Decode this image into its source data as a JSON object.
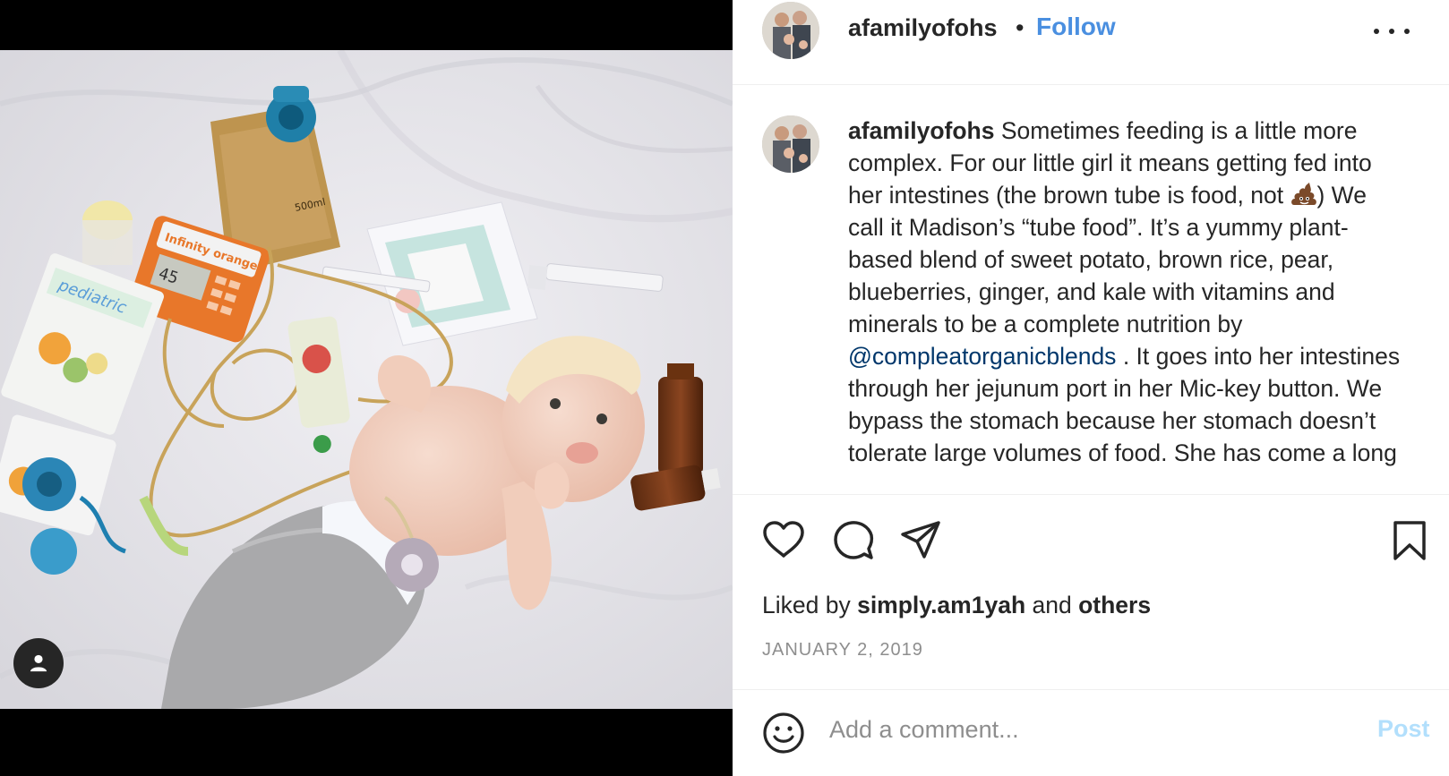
{
  "post": {
    "username": "afamilyofohs",
    "separator": "•",
    "follow_label": "Follow",
    "more_icon": "more-horizontal-icon",
    "caption": {
      "username": "afamilyofohs",
      "text_1": "Sometimes feeding is a little more complex. For our little girl it means getting fed into her intestines (the brown tube is food, not",
      "emoji": "poop-emoji",
      "text_2": ") We call it Madison’s “tube food”. It’s a yummy plant-based blend of sweet potato, brown rice, pear, blueberries, ginger, and kale with vitamins and minerals to be a complete nutrition by",
      "mention": "@compleatorganicblends",
      "text_3": ". It goes into her intestines through her jejunum port in her Mic-key button. We bypass the stomach because her stomach doesn’t tolerate large volumes of food. She has come a long"
    },
    "actions": {
      "like_icon": "heart-icon",
      "comment_icon": "comment-icon",
      "share_icon": "share-icon",
      "save_icon": "bookmark-icon"
    },
    "likes": {
      "prefix": "Liked by",
      "user": "simply.am1yah",
      "conjunction": "and",
      "others": "others"
    },
    "date": "JANUARY 2, 2019",
    "comment": {
      "placeholder": "Add a comment...",
      "post_label": "Post",
      "emoji_icon": "smiley-icon"
    },
    "media": {
      "tag_icon": "user-tag-icon",
      "product_label": "Infinity orange",
      "bag_label": "500ml",
      "pouch_label": "pediatric",
      "pump_display": "45"
    }
  }
}
